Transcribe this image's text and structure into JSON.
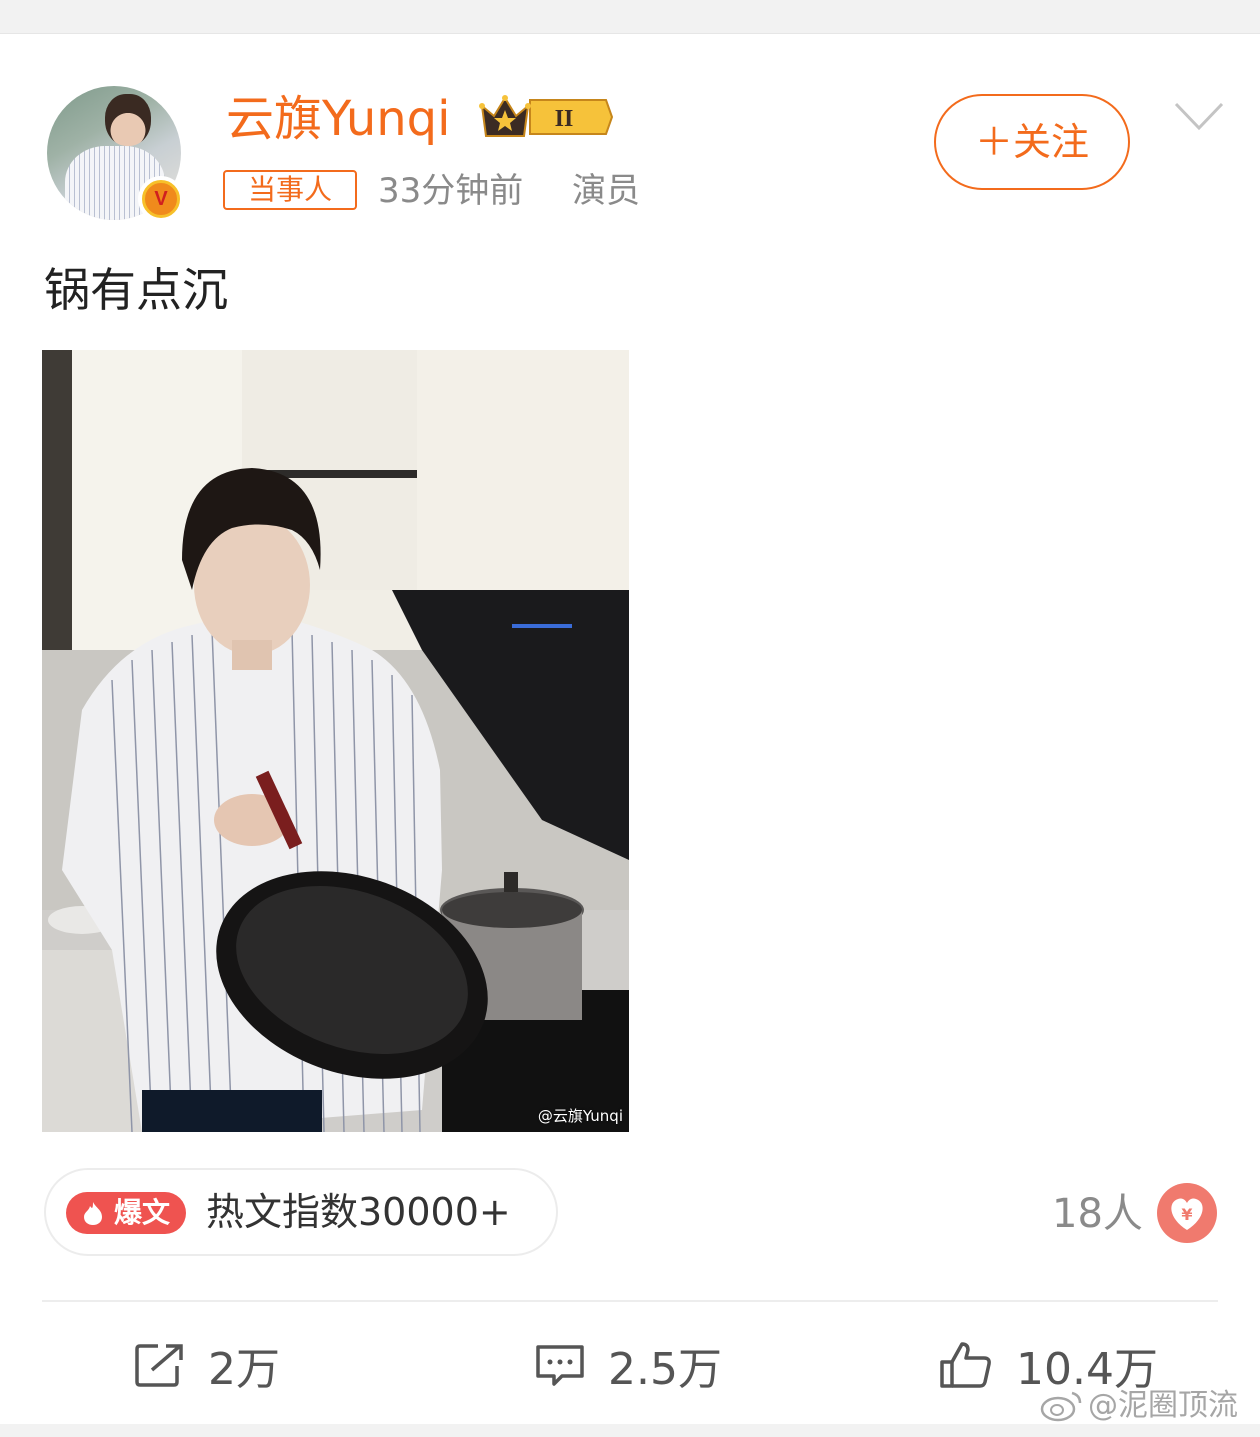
{
  "post": {
    "username": "云旗Yunqi",
    "member_level": "II",
    "tag": "当事人",
    "time": "33分钟前",
    "role": "演员",
    "follow_label": "＋关注",
    "text": "锅有点沉",
    "image_watermark": "@云旗Yunqi"
  },
  "hot": {
    "badge": "爆文",
    "index_text": "热文指数30000+"
  },
  "reward": {
    "count": "18人",
    "icon": "heart-yuan-icon"
  },
  "actions": {
    "repost": "2万",
    "comment": "2.5万",
    "like": "10.4万"
  },
  "footer": {
    "watermark": "@泥圈顶流"
  },
  "colors": {
    "accent": "#f36b1c",
    "hot_red": "#ef5350",
    "muted_text": "#8a8a8a"
  }
}
